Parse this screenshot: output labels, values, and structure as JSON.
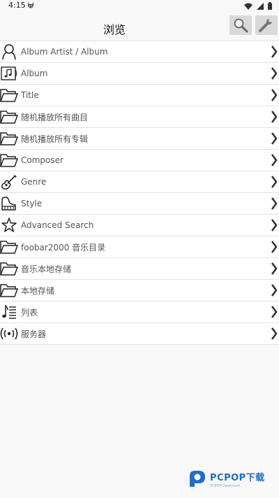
{
  "status": {
    "time": "4:15"
  },
  "header": {
    "title": "浏览"
  },
  "items": [
    {
      "label": "Album Artist / Album",
      "icon": "person-icon"
    },
    {
      "label": "Album",
      "icon": "album-icon"
    },
    {
      "label": "Title",
      "icon": "folder-icon"
    },
    {
      "label": "随机播放所有曲目",
      "icon": "folder-icon"
    },
    {
      "label": "随机播放所有专辑",
      "icon": "folder-icon"
    },
    {
      "label": "Composer",
      "icon": "folder-icon"
    },
    {
      "label": "Genre",
      "icon": "guitar-icon"
    },
    {
      "label": "Style",
      "icon": "piano-icon"
    },
    {
      "label": "Advanced Search",
      "icon": "star-icon"
    },
    {
      "label": "foobar2000 音乐目录",
      "icon": "folder-icon"
    },
    {
      "label": "音乐本地存储",
      "icon": "folder-icon"
    },
    {
      "label": "本地存储",
      "icon": "folder-icon"
    },
    {
      "label": "列表",
      "icon": "playlist-icon"
    },
    {
      "label": "服务器",
      "icon": "broadcast-icon"
    }
  ],
  "watermark": {
    "main": "PCPOP下载",
    "sub": "PCPOP Download"
  },
  "colors": {
    "accent": "#1f6fc7",
    "button_bg": "#d9d9d9"
  }
}
